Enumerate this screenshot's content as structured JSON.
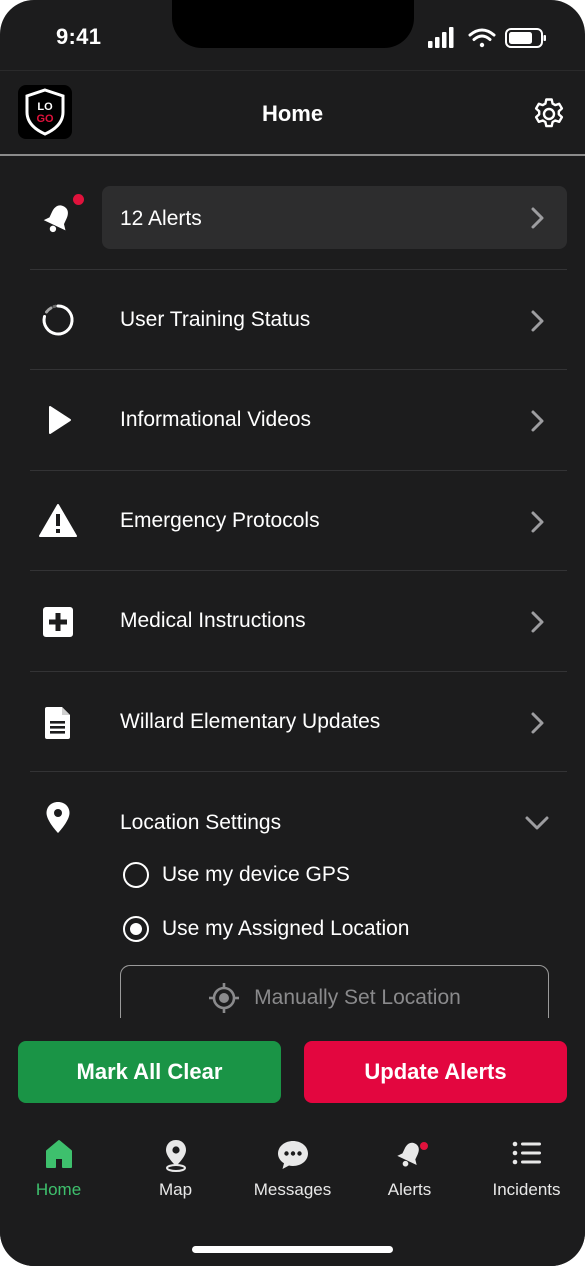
{
  "status_bar": {
    "time": "9:41"
  },
  "header": {
    "title": "Home",
    "logo_text_top": "LO",
    "logo_text_bottom": "GO"
  },
  "menu": {
    "alerts": {
      "label": "12 Alerts",
      "icon": "bell-icon"
    },
    "items": [
      {
        "label": "User Training Status",
        "icon": "progress-spinner-icon"
      },
      {
        "label": "Informational Videos",
        "icon": "play-icon"
      },
      {
        "label": "Emergency Protocols",
        "icon": "warning-icon"
      },
      {
        "label": "Medical Instructions",
        "icon": "medical-cross-icon"
      },
      {
        "label": "Willard Elementary Updates",
        "icon": "document-icon"
      }
    ],
    "location": {
      "label": "Location Settings",
      "icon": "location-pin-icon",
      "options": [
        {
          "label": "Use my device GPS",
          "selected": false
        },
        {
          "label": "Use my Assigned Location",
          "selected": true
        }
      ],
      "manual_button": "Manually Set Location"
    }
  },
  "actions": {
    "clear": "Mark All Clear",
    "update": "Update Alerts"
  },
  "tabs": [
    {
      "label": "Home",
      "icon": "home-icon",
      "active": true
    },
    {
      "label": "Map",
      "icon": "map-pin-icon",
      "active": false
    },
    {
      "label": "Messages",
      "icon": "chat-bubble-icon",
      "active": false
    },
    {
      "label": "Alerts",
      "icon": "bell-icon",
      "active": false
    },
    {
      "label": "Incidents",
      "icon": "list-icon",
      "active": false
    }
  ],
  "colors": {
    "background": "#1c1c1d",
    "card": "#2d2d2e",
    "green": "#1a9446",
    "red": "#e3063f",
    "active_tab": "#3ec06d"
  }
}
